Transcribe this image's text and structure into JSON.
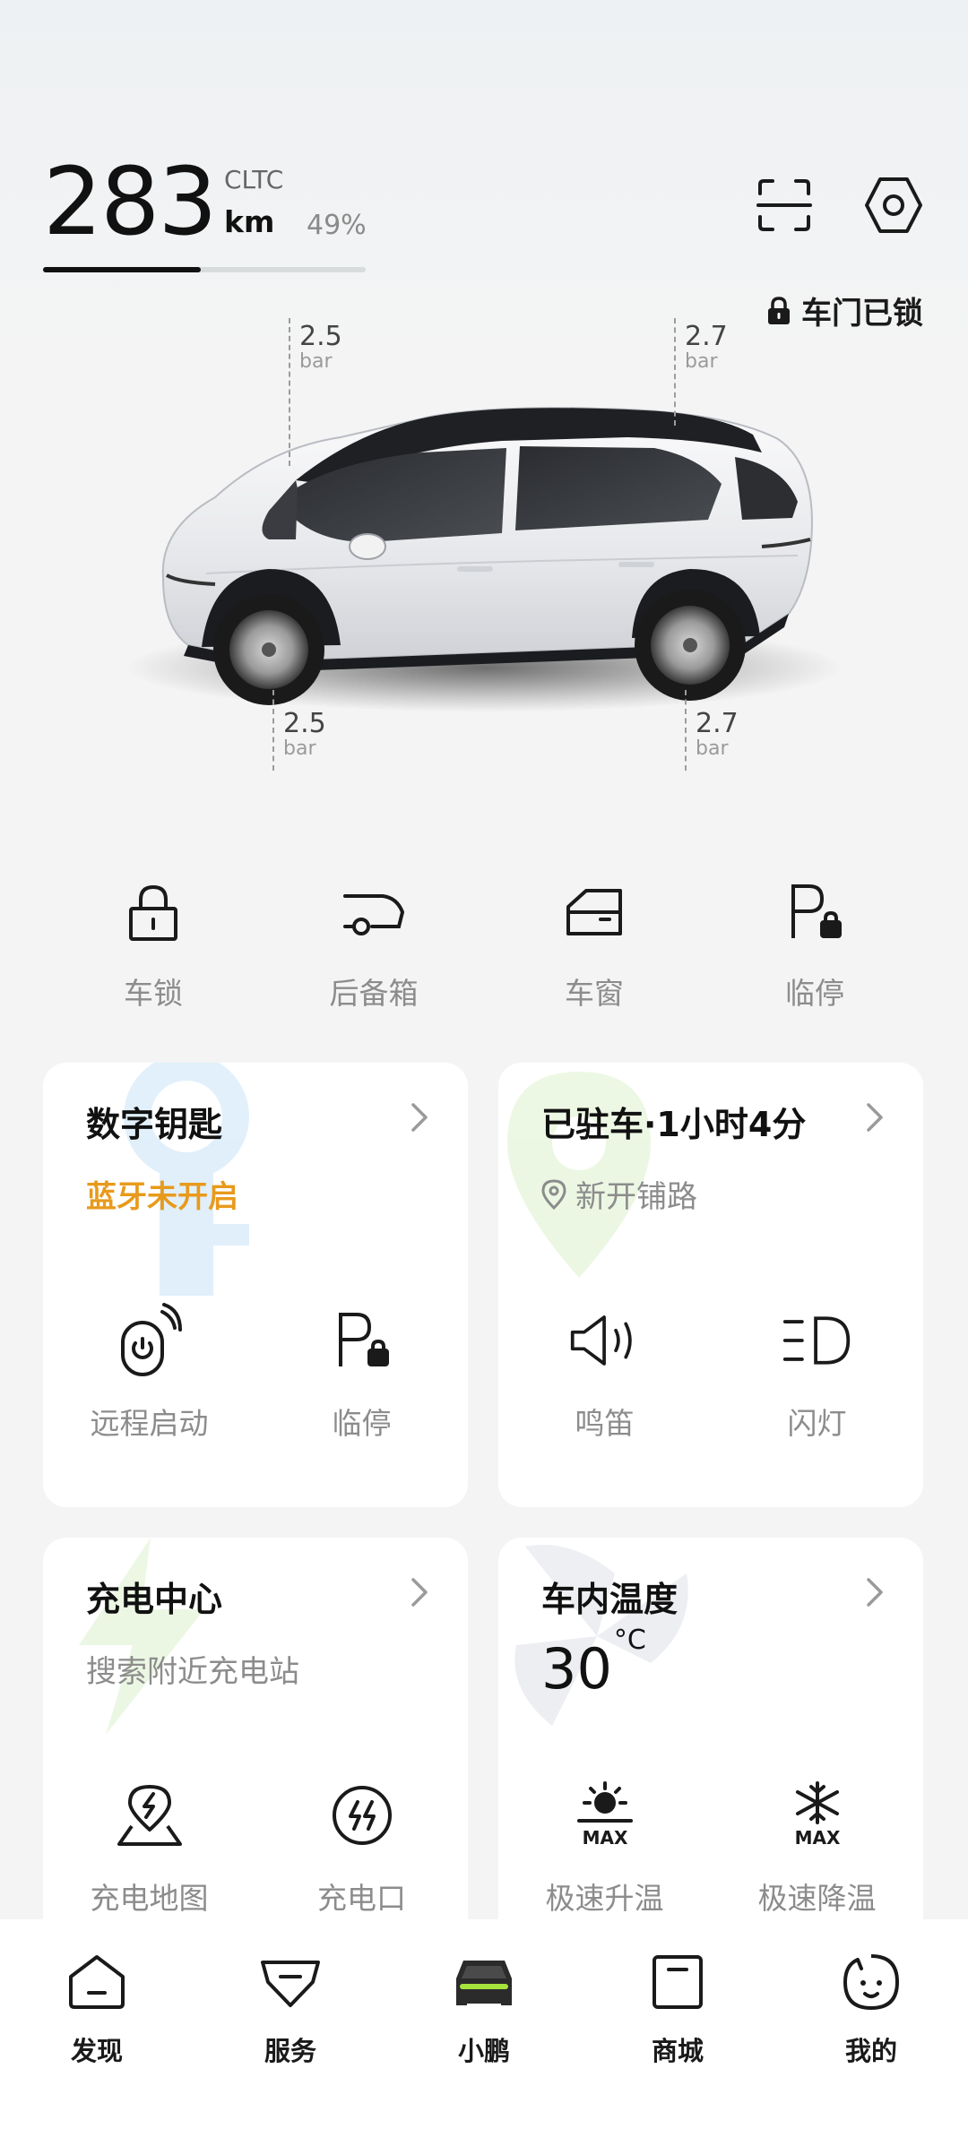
{
  "status": {
    "range_value": "283",
    "range_standard": "CLTC",
    "range_unit": "km",
    "battery_percent_label": "49%",
    "battery_fraction": 0.49,
    "door_status": "车门已锁"
  },
  "tires": {
    "front_left": {
      "value": "2.5",
      "unit": "bar"
    },
    "rear_left": {
      "value": "2.7",
      "unit": "bar"
    },
    "front_right": {
      "value": "2.5",
      "unit": "bar"
    },
    "rear_right": {
      "value": "2.7",
      "unit": "bar"
    }
  },
  "quick_controls": [
    {
      "label": "车锁",
      "icon": "lock-icon"
    },
    {
      "label": "后备箱",
      "icon": "trunk-icon"
    },
    {
      "label": "车窗",
      "icon": "window-icon"
    },
    {
      "label": "临停",
      "icon": "parking-icon"
    }
  ],
  "cards": {
    "digital_key": {
      "title": "数字钥匙",
      "subtitle": "蓝牙未开启",
      "actions": [
        {
          "label": "远程启动",
          "icon": "remote-start-icon"
        },
        {
          "label": "临停",
          "icon": "parking-icon"
        }
      ]
    },
    "parked": {
      "title": "已驻车·1小时4分",
      "location": "新开铺路",
      "actions": [
        {
          "label": "鸣笛",
          "icon": "horn-icon"
        },
        {
          "label": "闪灯",
          "icon": "headlight-icon"
        }
      ]
    },
    "charging": {
      "title": "充电中心",
      "subtitle": "搜索附近充电站",
      "actions": [
        {
          "label": "充电地图",
          "icon": "charge-map-icon"
        },
        {
          "label": "充电口",
          "icon": "charge-port-icon"
        }
      ]
    },
    "cabin_temp": {
      "title": "车内温度",
      "value": "30",
      "unit": "°C",
      "actions": [
        {
          "label": "极速升温",
          "icon": "max-heat-icon",
          "badge": "MAX"
        },
        {
          "label": "极速降温",
          "icon": "max-cool-icon",
          "badge": "MAX"
        }
      ]
    }
  },
  "bottom_nav": [
    {
      "label": "发现",
      "icon": "discover-icon",
      "active": false
    },
    {
      "label": "服务",
      "icon": "service-icon",
      "active": false
    },
    {
      "label": "小鹏",
      "icon": "car-icon",
      "active": true
    },
    {
      "label": "商城",
      "icon": "shop-icon",
      "active": false
    },
    {
      "label": "我的",
      "icon": "profile-icon",
      "active": false
    }
  ],
  "colors": {
    "accent_warning": "#e89a1c",
    "active_nav_accent": "#a6e33b",
    "text_primary": "#111111",
    "text_secondary": "#8c8c8c"
  }
}
